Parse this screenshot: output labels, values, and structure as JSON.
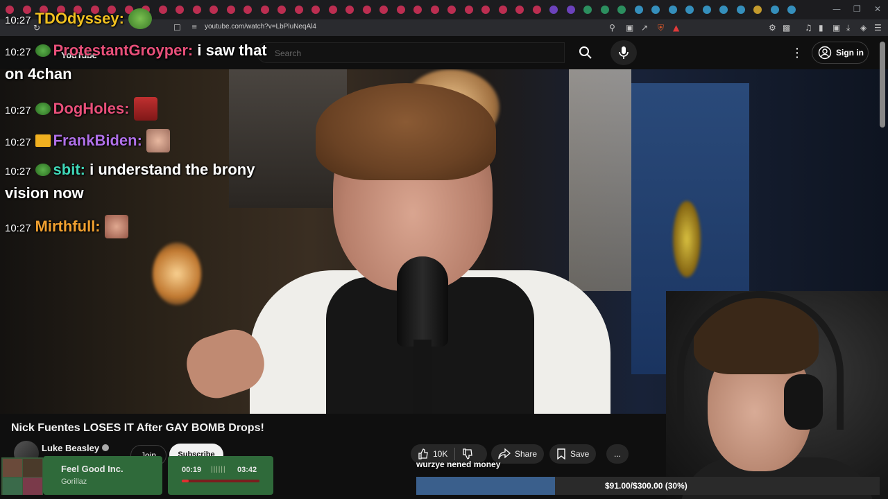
{
  "browser": {
    "url": "youtube.com/watch?v=LbPluNeqAl4",
    "tab_colors": [
      "#d8315b",
      "#d8315b",
      "#d8315b",
      "#2fa36b",
      "#7a49d8",
      "#3aa3d8",
      "#e0b030"
    ]
  },
  "youtube": {
    "logo": "YouTube",
    "search_placeholder": "Search",
    "signin_label": "Sign in",
    "video_title": "Nick Fuentes LOSES IT After GAY BOMB Drops!",
    "channel_name": "Luke Beasley",
    "join_label": "Join",
    "subscribe_label": "Subscribe",
    "likes": "10K",
    "share_label": "Share",
    "save_label": "Save",
    "more_actions": "..."
  },
  "chat": {
    "top_user": {
      "time": "10:27",
      "name": "TDOdyssey:",
      "color": "#f0c020"
    },
    "messages": [
      {
        "time": "10:27",
        "name": "ProtestantGroyper:",
        "color": "#e8507a",
        "message": "i saw that",
        "continuation": "on 4chan"
      },
      {
        "time": "10:27",
        "name": "DogHoles:",
        "color": "#e8507a",
        "message": "",
        "continuation": ""
      },
      {
        "time": "10:27",
        "name": "FrankBiden:",
        "color": "#b070e8",
        "message": "",
        "continuation": ""
      },
      {
        "time": "10:27",
        "name": "sbit:",
        "color": "#40d8b8",
        "message": "i understand the brony",
        "continuation": "vision now"
      },
      {
        "time": "10:27",
        "name": "Mirthfull:",
        "color": "#f0a030",
        "message": "",
        "continuation": ""
      }
    ]
  },
  "spotify": {
    "track": "Feel Good Inc.",
    "artist": "Gorillaz",
    "current": "00:19",
    "duration": "03:42",
    "progress": 0.086,
    "eq_glyph": "||||||"
  },
  "donation": {
    "donor_text": "wurzye nened money",
    "goal_text": "$91.00/$300.00 (30%)",
    "progress": 0.3
  }
}
